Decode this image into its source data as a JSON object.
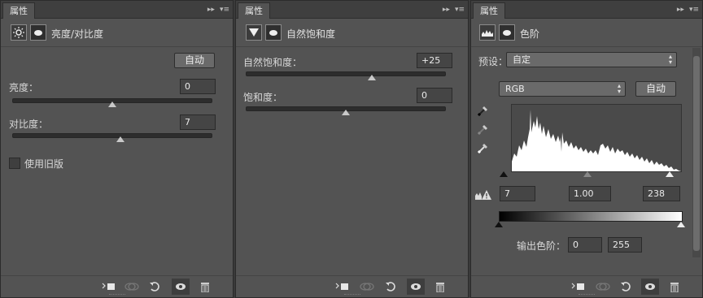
{
  "panels": [
    {
      "tab": "属性",
      "title": "亮度/对比度",
      "auto_label": "自动",
      "fields": [
        {
          "label": "亮度：",
          "value": "0",
          "slider_pos": 0.5
        },
        {
          "label": "对比度：",
          "value": "7",
          "slider_pos": 0.55
        }
      ],
      "legacy_label": "使用旧版"
    },
    {
      "tab": "属性",
      "title": "自然饱和度",
      "fields": [
        {
          "label": "自然饱和度：",
          "value": "+25",
          "slider_pos": 0.625
        },
        {
          "label": "饱和度：",
          "value": "0",
          "slider_pos": 0.5
        }
      ]
    },
    {
      "tab": "属性",
      "title": "色阶",
      "preset_label": "预设：",
      "preset_value": "自定",
      "channel_value": "RGB",
      "auto_label": "自动",
      "input_black": "7",
      "input_mid": "1.00",
      "input_white": "238",
      "output_label": "输出色阶：",
      "output_black": "0",
      "output_white": "255"
    }
  ],
  "icons": {
    "brightness": "sun-icon",
    "vibrance": "vibrance-triangle-icon",
    "levels": "histogram-icon",
    "mask": "mask-icon",
    "clip": "clip-to-layer-icon",
    "view_previous": "view-previous-icon",
    "reset": "reset-icon",
    "visibility": "eye-icon",
    "delete": "trash-icon"
  }
}
